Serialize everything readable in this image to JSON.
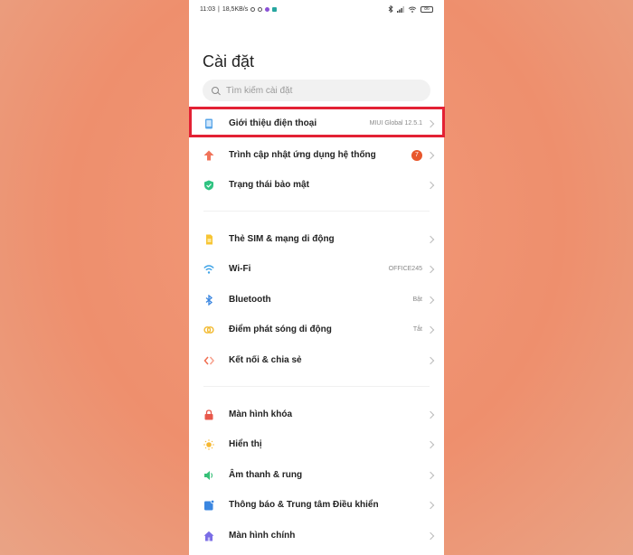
{
  "statusbar": {
    "time": "11:03",
    "speed": "18,5KB/s",
    "battery": "86"
  },
  "page": {
    "title": "Cài đặt"
  },
  "search": {
    "placeholder": "Tìm kiếm cài đặt"
  },
  "groups": [
    {
      "items": [
        {
          "label": "Giới thiệu điện thoại",
          "value": "MIUI Global 12.5.1",
          "icon": "phone-info-icon"
        },
        {
          "label": "Trình cập nhật ứng dụng hệ thống",
          "badge": "7",
          "icon": "update-arrow-icon"
        },
        {
          "label": "Trạng thái bảo mật",
          "icon": "shield-icon"
        }
      ]
    },
    {
      "items": [
        {
          "label": "Thẻ SIM & mạng di động",
          "icon": "sim-card-icon"
        },
        {
          "label": "Wi-Fi",
          "value": "OFFICE245",
          "icon": "wifi-icon"
        },
        {
          "label": "Bluetooth",
          "value": "Bật",
          "icon": "bluetooth-icon"
        },
        {
          "label": "Điểm phát sóng di động",
          "value": "Tắt",
          "icon": "hotspot-icon"
        },
        {
          "label": "Kết nối & chia sẻ",
          "icon": "connection-share-icon"
        }
      ]
    },
    {
      "items": [
        {
          "label": "Màn hình khóa",
          "icon": "lock-icon"
        },
        {
          "label": "Hiển thị",
          "icon": "sun-icon"
        },
        {
          "label": "Âm thanh & rung",
          "icon": "speaker-icon"
        },
        {
          "label": "Thông báo & Trung tâm Điều khiển",
          "icon": "notification-icon"
        },
        {
          "label": "Màn hình chính",
          "icon": "home-icon"
        }
      ]
    }
  ],
  "colors": {
    "highlight": "#e32134",
    "background": "#ee8f6d",
    "badge": "#e8572c"
  }
}
